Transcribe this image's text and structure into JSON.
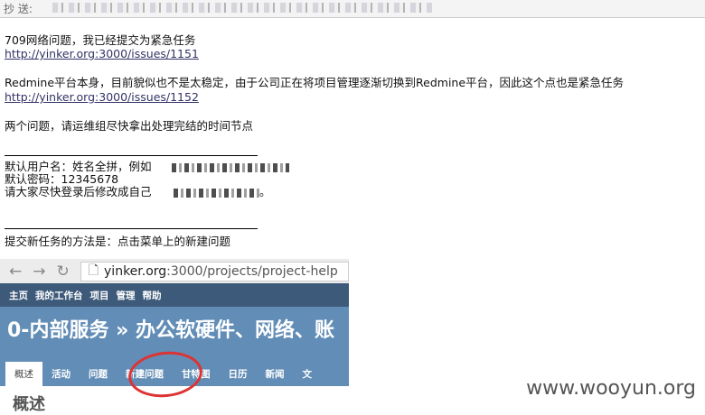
{
  "header": {
    "cc_label": "抄 送:"
  },
  "body": {
    "line1": "709网络问题，我已经提交为紧急任务",
    "link1": "http://yinker.org:3000/issues/1151",
    "line2": "Redmine平台本身，目前貌似也不是太稳定，由于公司正在将项目管理逐渐切换到Redmine平台，因此这个点也是紧急任务",
    "link2": "http://yinker.org:3000/issues/1152",
    "line3": "两个问题，请运维组尽快拿出处理完结的时间节点",
    "user_line": "默认用户名：姓名全拼，例如",
    "pwd_line": "默认密码：12345678",
    "change_line_a": "请大家尽快登录后修改成自己",
    "change_line_b": "。",
    "howto": "提交新任务的方法是：点击菜单上的新建问题"
  },
  "screenshot": {
    "url_host": "yinker.org",
    "url_rest": ":3000/projects/project-help",
    "top_nav": [
      "主页",
      "我的工作台",
      "项目",
      "管理",
      "帮助"
    ],
    "project_title": "0-内部服务 » 办公软硬件、网络、账",
    "tabs": [
      "概述",
      "活动",
      "问题",
      "新建问题",
      "甘特图",
      "日历",
      "新闻",
      "文"
    ],
    "active_tab": "概述",
    "highlight_color": "#d33333",
    "heading": "概述"
  },
  "watermark": "www.wooyun.org"
}
